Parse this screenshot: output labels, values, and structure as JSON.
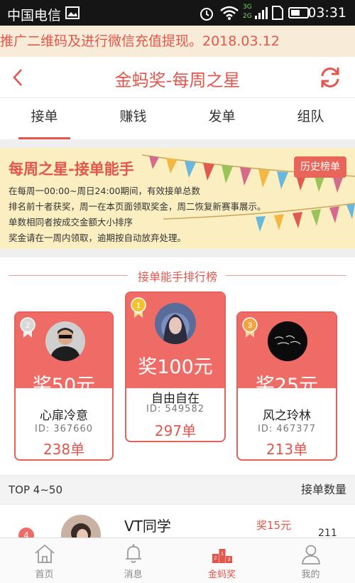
{
  "status_bar": {
    "carrier": "中国电信",
    "time": "03:31",
    "network_badge": "3G 2G"
  },
  "marquee": {
    "text": "推广二维码及进行微信充值提现。2018.03.12"
  },
  "header": {
    "title": "金蚂奖-每周之星"
  },
  "tabs": [
    {
      "label": "接单",
      "active": true
    },
    {
      "label": "赚钱",
      "active": false
    },
    {
      "label": "发单",
      "active": false
    },
    {
      "label": "组队",
      "active": false
    }
  ],
  "banner": {
    "title": "每周之星-接单能手",
    "history_button": "历史榜单",
    "lines": [
      "在每周一00:00~周日24:00期间，有效接单总数",
      "排名前十者获奖，周一在本页面领取奖金，周二恢复新赛事展示。",
      "单数相同者按成交金额大小排序",
      "奖金请在一周内领取，逾期按自动放弃处理。"
    ]
  },
  "ranking": {
    "title": "接单能手排行榜",
    "first": {
      "rank": "1",
      "prize": "奖100元",
      "name": "自由自在",
      "id": "ID: 549582",
      "count": "297单"
    },
    "second": {
      "rank": "2",
      "prize": "奖50元",
      "name": "心扉冷意",
      "id": "ID: 367660",
      "count": "238单"
    },
    "third": {
      "rank": "3",
      "prize": "奖25元",
      "name": "风之玲林",
      "id": "ID: 467377",
      "count": "213单"
    }
  },
  "top_list": {
    "header_left": "TOP 4~50",
    "header_right": "接单数量",
    "rows": [
      {
        "rank": "4",
        "name": "VT同学",
        "prize": "奖15元",
        "count": "211"
      }
    ]
  },
  "bottom_nav": [
    {
      "label": "首页",
      "icon": "home-icon",
      "active": false
    },
    {
      "label": "消息",
      "icon": "bell-icon",
      "active": false
    },
    {
      "label": "金蚂奖",
      "icon": "podium-icon",
      "active": true
    },
    {
      "label": "我的",
      "icon": "user-icon",
      "active": false
    }
  ],
  "colors": {
    "accent": "#e4554c",
    "banner_bg": "#fbeec0",
    "marquee_bg": "#f8ecd8"
  }
}
